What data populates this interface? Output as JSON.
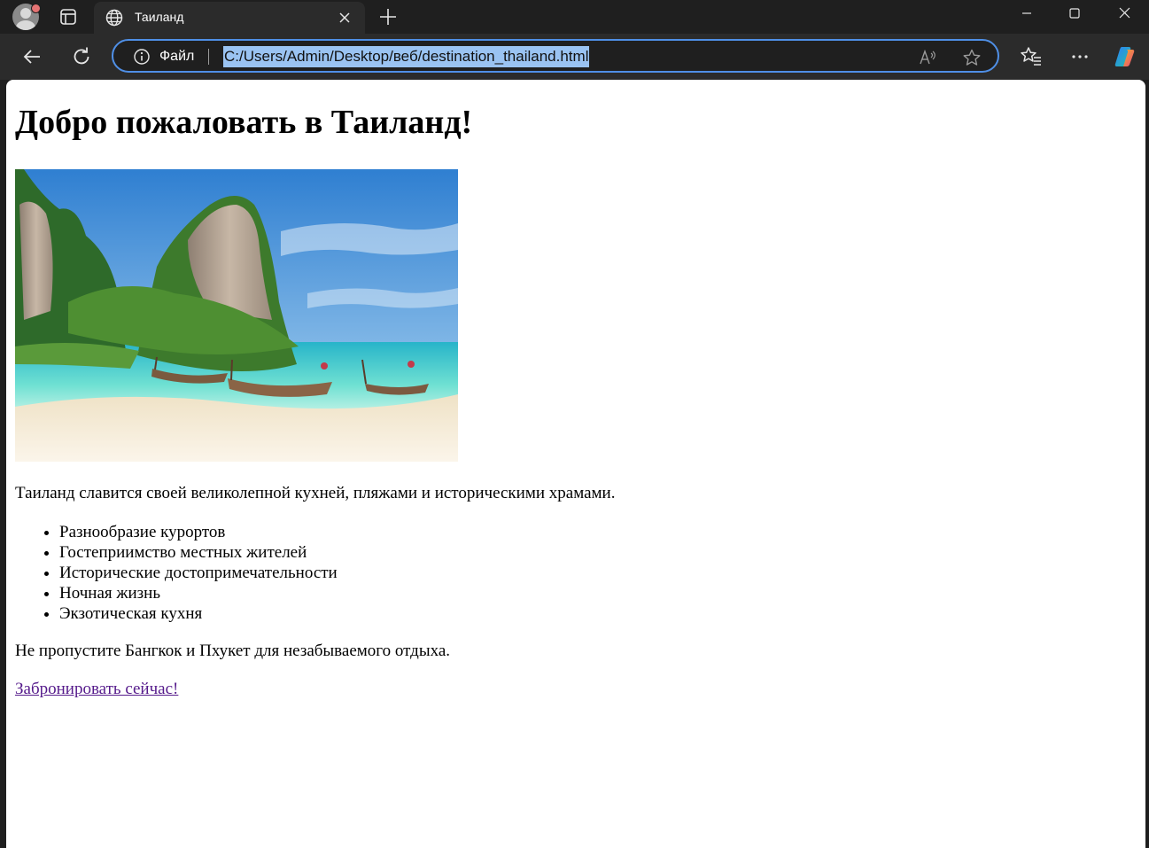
{
  "browser": {
    "tab": {
      "title": "Таиланд"
    },
    "address_bar": {
      "scheme_label": "Файл",
      "url": "C:/Users/Admin/Desktop/веб/destination_thailand.html"
    },
    "icons": {
      "profile": "avatar-icon",
      "tab_actions": "tab-actions-icon",
      "tab_favicon": "globe-icon",
      "close_tab": "close-icon",
      "new_tab": "plus-icon",
      "back": "arrow-left-icon",
      "reload": "reload-icon",
      "site_info": "info-icon",
      "read_aloud": "read-aloud-icon",
      "add_favorite": "star-icon",
      "favorites": "favorites-icon",
      "more": "more-icon",
      "copilot": "copilot-icon"
    },
    "colors": {
      "frame": "#1f1f1f",
      "toolbar": "#2b2b2b",
      "omnibox_border": "#4f8fe6",
      "url_selection": "#9ac3f2"
    }
  },
  "page": {
    "heading": "Добро пожаловать в Таиланд!",
    "intro": "Таиланд славится своей великолепной кухней, пляжами и историческими храмами.",
    "features": [
      "Разнообразие курортов",
      "Гостеприимство местных жителей",
      "Исторические достопримечательности",
      "Ночная жизнь",
      "Экзотическая кухня"
    ],
    "outro": "Не пропустите Бангкок и Пхукет для незабываемого отдыха.",
    "book_link": "Забронировать сейчас!",
    "link_color": "#551a8b"
  }
}
